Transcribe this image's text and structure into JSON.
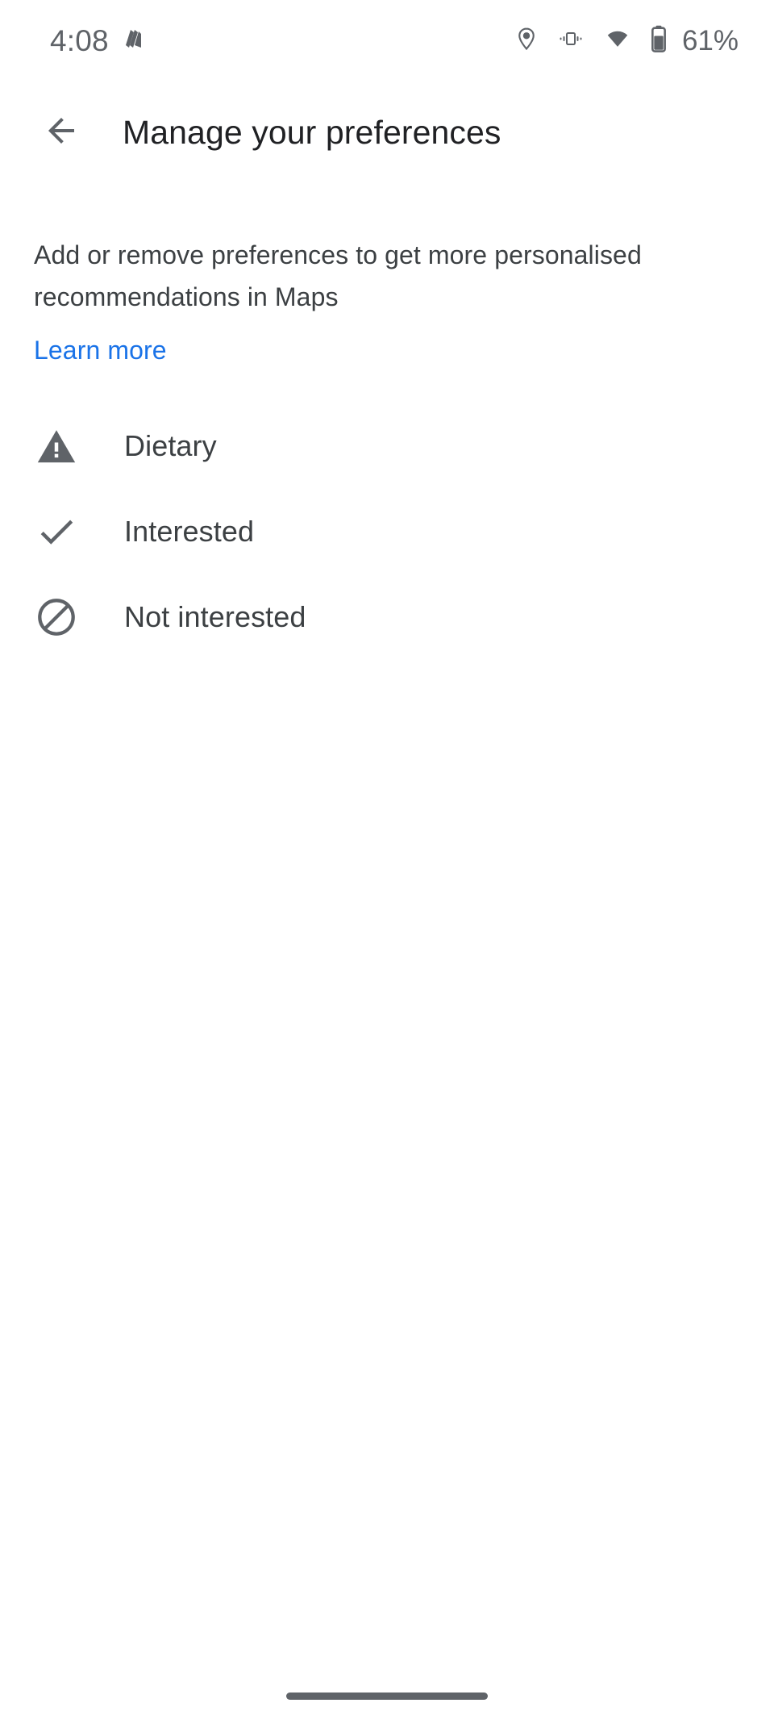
{
  "status_bar": {
    "time": "4:08",
    "notification_icon": "layers-notification-icon",
    "icons": [
      "location-pin-icon",
      "vibrate-icon",
      "wifi-icon",
      "battery-icon"
    ],
    "battery_percent": "61%",
    "icon_color": "#5f6368"
  },
  "app_bar": {
    "back_icon": "back-arrow-icon",
    "title": "Manage your preferences"
  },
  "body": {
    "description": "Add or remove preferences to get more personalised recommendations in Maps",
    "learn_more_label": "Learn more",
    "learn_more_color": "#1a73e8"
  },
  "preferences": {
    "items": [
      {
        "label": "Dietary",
        "icon": "warning-triangle-icon"
      },
      {
        "label": "Interested",
        "icon": "check-icon"
      },
      {
        "label": "Not interested",
        "icon": "block-icon"
      }
    ]
  },
  "nav_bar": {
    "handle": "gesture-nav-handle"
  },
  "colors": {
    "background": "#ffffff",
    "primary_text": "#202124",
    "secondary_text": "#3c4043",
    "icon": "#5f6368",
    "link": "#1a73e8"
  }
}
